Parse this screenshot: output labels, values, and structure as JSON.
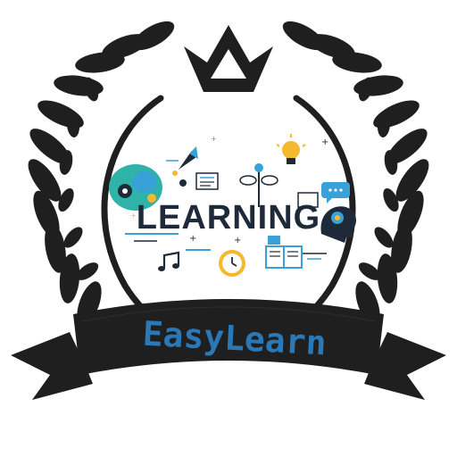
{
  "logo": {
    "graphic_word": "LEARNING",
    "brand_name": "EasyLearn",
    "icons": [
      "crown-icon",
      "laurel-wreath-icon",
      "brain-gear-icon",
      "rocket-icon",
      "lightbulb-icon",
      "document-icon",
      "clock-icon",
      "book-icon",
      "music-note-icon",
      "plant-sprout-icon",
      "head-lightbulb-icon",
      "speech-bubble-icon",
      "ribbon-banner-icon"
    ]
  },
  "colors": {
    "wreath": "#1f1f1f",
    "banner": "#1f1f1f",
    "brand_text": "#2a78b5",
    "learning_text": "#1e2a3a",
    "accent_blue": "#3aa0d8",
    "accent_yellow": "#f5b82e",
    "accent_green": "#7cc242",
    "accent_teal": "#2fb3a8"
  }
}
